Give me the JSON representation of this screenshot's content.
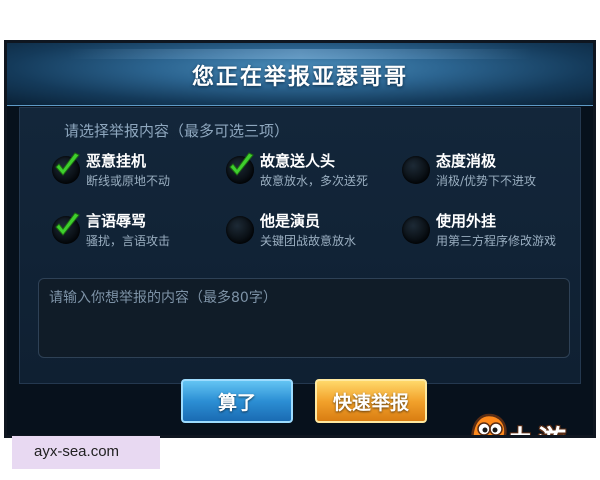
{
  "dialog": {
    "title": "您正在举报亚瑟哥哥",
    "instruction": "请选择举报内容（最多可选三项）",
    "options": [
      {
        "label": "恶意挂机",
        "desc": "断线或原地不动",
        "checked": true
      },
      {
        "label": "故意送人头",
        "desc": "故意放水，多次送死",
        "checked": true
      },
      {
        "label": "态度消极",
        "desc": "消极/优势下不进攻",
        "checked": false
      },
      {
        "label": "言语辱骂",
        "desc": "骚扰，言语攻击",
        "checked": true
      },
      {
        "label": "他是演员",
        "desc": "关键团战故意放水",
        "checked": false
      },
      {
        "label": "使用外挂",
        "desc": "用第三方程序修改游戏",
        "checked": false
      }
    ],
    "textarea_placeholder": "请输入你想举报的内容（最多80字）",
    "cancel_label": "算了",
    "report_label": "快速举报"
  },
  "logo": {
    "text": "九游"
  },
  "watermark": {
    "text": "ayx-sea.com"
  },
  "colors": {
    "check_green": "#3fcf2e",
    "cancel_blue": "#2c8fd4",
    "report_orange": "#f2a22c"
  }
}
